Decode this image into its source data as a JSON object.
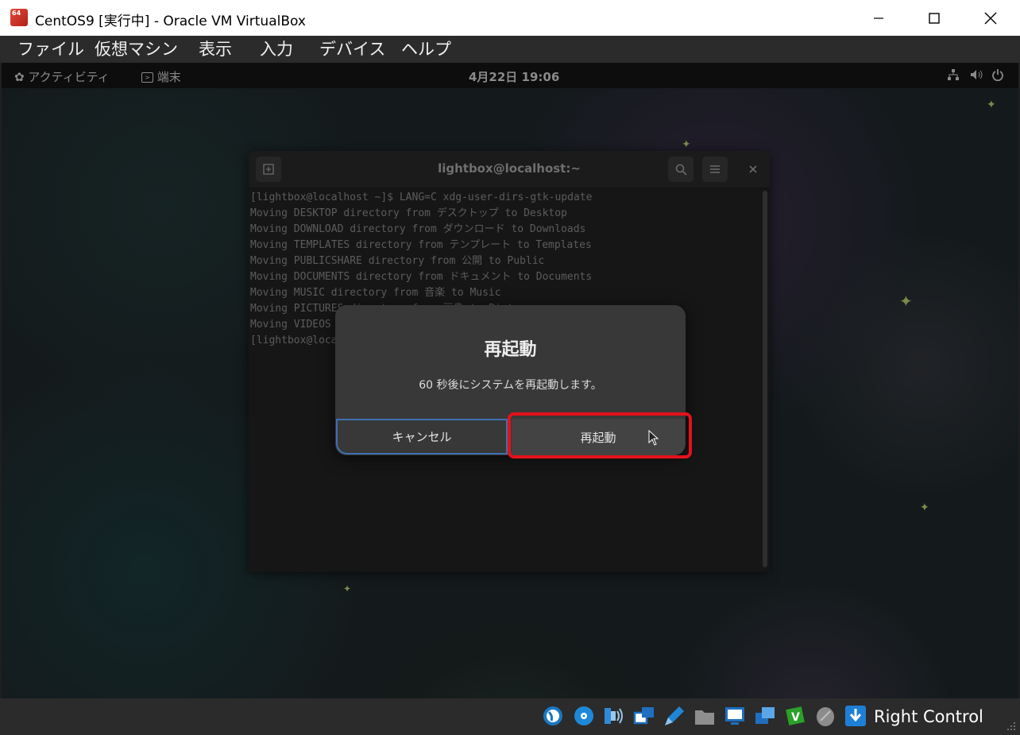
{
  "window": {
    "title": "CentOS9 [実行中] - Oracle VM VirtualBox",
    "icon_label": "64"
  },
  "menubar": {
    "items": [
      "ファイル",
      "仮想マシン",
      "表示",
      "入力",
      "デバイス",
      "ヘルプ"
    ]
  },
  "gnome_topbar": {
    "activities": "アクティビティ",
    "app": "端末",
    "clock": "4月22日  19:06"
  },
  "terminal": {
    "title": "lightbox@localhost:~",
    "lines": [
      "[lightbox@localhost ~]$ LANG=C xdg-user-dirs-gtk-update",
      "Moving DESKTOP directory from デスクトップ to Desktop",
      "Moving DOWNLOAD directory from ダウンロード to Downloads",
      "Moving TEMPLATES directory from テンプレート to Templates",
      "Moving PUBLICSHARE directory from 公開 to Public",
      "Moving DOCUMENTS directory from ドキュメント to Documents",
      "Moving MUSIC directory from 音楽 to Music",
      "Moving PICTURES directory from 画像 to Pictures",
      "Moving VIDEOS directory from ビデオ to Videos",
      "[lightbox@localhost ~]$ "
    ]
  },
  "dialog": {
    "title": "再起動",
    "message": "60 秒後にシステムを再起動します。",
    "cancel_label": "キャンセル",
    "restart_label": "再起動"
  },
  "statusbar": {
    "host_key": "Right Control",
    "icons": [
      "hard-disk-icon",
      "optical-drive-icon",
      "audio-icon",
      "network-icon",
      "usb-icon",
      "shared-folders-icon",
      "display-icon",
      "video-capture-icon",
      "cpu-icon",
      "mouse-integration-icon",
      "keyboard-capture-icon"
    ]
  },
  "colors": {
    "highlight": "#e4111a",
    "cancel_focus": "#3f6fb0"
  }
}
